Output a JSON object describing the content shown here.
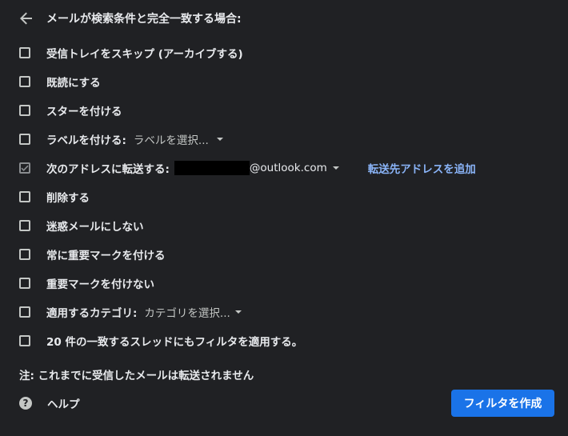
{
  "header": {
    "title": "メールが検索条件と完全一致する場合:"
  },
  "options": {
    "skip_inbox": "受信トレイをスキップ (アーカイブする)",
    "mark_read": "既読にする",
    "star": "スターを付ける",
    "apply_label": {
      "label": "ラベルを付ける:",
      "value": "ラベルを選択..."
    },
    "forward": {
      "label": "次のアドレスに転送する:",
      "email_suffix": "@outlook.com",
      "add_link": "転送先アドレスを追加",
      "checked": true
    },
    "delete": "削除する",
    "never_spam": "迷惑メールにしない",
    "always_important": "常に重要マークを付ける",
    "never_important": "重要マークを付けない",
    "category": {
      "label": "適用するカテゴリ:",
      "value": "カテゴリを選択..."
    },
    "apply_existing": "20 件の一致するスレッドにもフィルタを適用する。"
  },
  "note": "注: これまでに受信したメールは転送されません",
  "help": {
    "icon": "?",
    "label": "ヘルプ"
  },
  "create_button": "フィルタを作成",
  "colors": {
    "background": "#202124",
    "text": "#e8eaed",
    "link": "#8ab4f8",
    "primary_button": "#1a73e8"
  }
}
